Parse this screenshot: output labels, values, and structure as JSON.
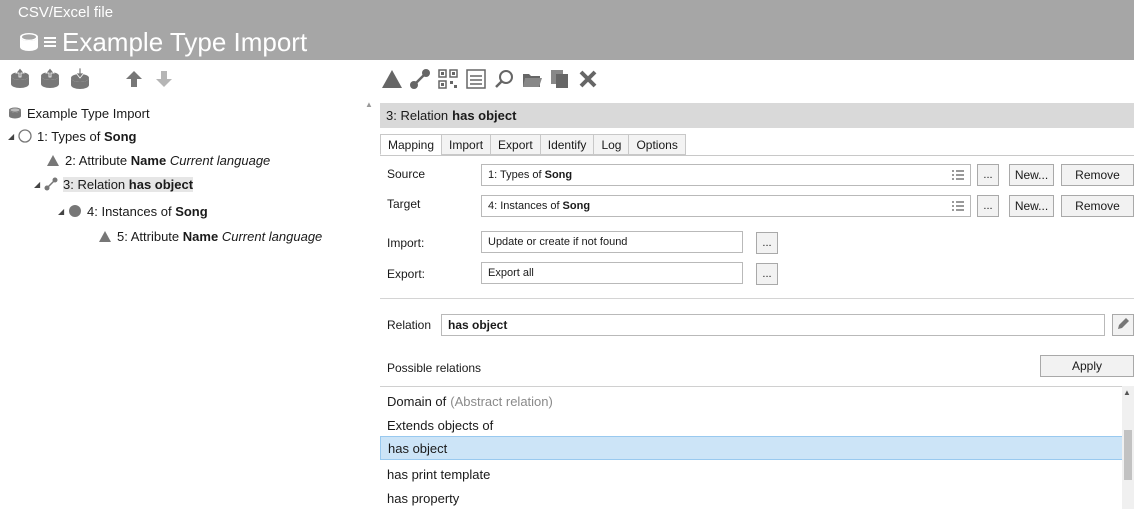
{
  "header": {
    "subtitle": "CSV/Excel file",
    "title": "Example Type Import"
  },
  "tree": {
    "items": [
      {
        "label": "Example Type Import"
      },
      {
        "prefix": "1: Types of",
        "bold": "Song"
      },
      {
        "prefix": "2: Attribute",
        "bold": "Name",
        "italic": "Current language"
      },
      {
        "prefix": "3: Relation",
        "bold": "has object"
      },
      {
        "prefix": "4: Instances of",
        "bold": "Song"
      },
      {
        "prefix": "5: Attribute",
        "bold": "Name",
        "italic": "Current language"
      }
    ]
  },
  "panel": {
    "title_prefix": "3: Relation",
    "title_bold": "has object",
    "tabs": [
      "Mapping",
      "Import",
      "Export",
      "Identify",
      "Log",
      "Options"
    ],
    "active_tab": "Mapping",
    "source": {
      "label": "Source",
      "value_prefix": "1: Types of",
      "value_bold": "Song"
    },
    "target": {
      "label": "Target",
      "value_prefix": "4: Instances of",
      "value_bold": "Song"
    },
    "import": {
      "label": "Import:",
      "value": "Update or create if not found"
    },
    "export": {
      "label": "Export:",
      "value": "Export all"
    },
    "buttons": {
      "dots": "...",
      "new": "New...",
      "remove": "Remove",
      "apply": "Apply"
    },
    "relation": {
      "label": "Relation",
      "value": "has object"
    },
    "possible_label": "Possible relations",
    "relations": [
      {
        "label": "Domain of",
        "note": "(Abstract relation)"
      },
      {
        "label": "Extends objects of"
      },
      {
        "label": "has object",
        "selected": true
      },
      {
        "label": "has print template"
      },
      {
        "label": "has property"
      }
    ]
  }
}
